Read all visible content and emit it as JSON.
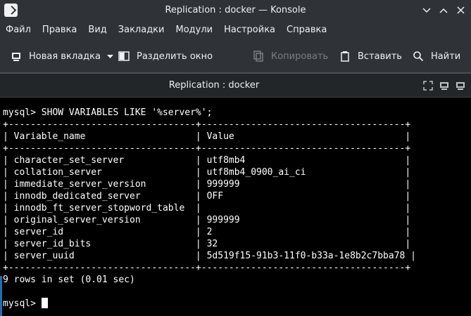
{
  "window": {
    "title": "Replication : docker — Konsole"
  },
  "menu": [
    "Файл",
    "Правка",
    "Вид",
    "Закладки",
    "Модули",
    "Настройка",
    "Справка"
  ],
  "toolbar": {
    "new_tab": "Новая вкладка",
    "split_view": "Разделить окно",
    "copy": "Копировать",
    "paste": "Вставить",
    "find": "Найти"
  },
  "tab": {
    "title": "Replication : docker"
  },
  "terminal": {
    "command_line": "mysql> SHOW VARIABLES LIKE '%server%';",
    "border": "+----------------------------------+-------------------------------------+",
    "header": "| Variable_name                    | Value                               |",
    "rows": [
      "| character_set_server             | utf8mb4                             |",
      "| collation_server                 | utf8mb4_0900_ai_ci                  |",
      "| immediate_server_version         | 999999                              |",
      "| innodb_dedicated_server          | OFF                                 |",
      "| innodb_ft_server_stopword_table  |                                     |",
      "| original_server_version          | 999999                              |",
      "| server_id                        | 2                                   |",
      "| server_id_bits                   | 32                                  |",
      "| server_uuid                      | 5d519f15-91b3-11f0-b33a-1e8b2c7bba78 |"
    ],
    "result": "9 rows in set (0.01 sec)",
    "prompt": "mysql> "
  },
  "colors": {
    "chrome_bg": "#2f3337",
    "terminal_bg": "#000000",
    "terminal_fg": "#ffffff"
  }
}
